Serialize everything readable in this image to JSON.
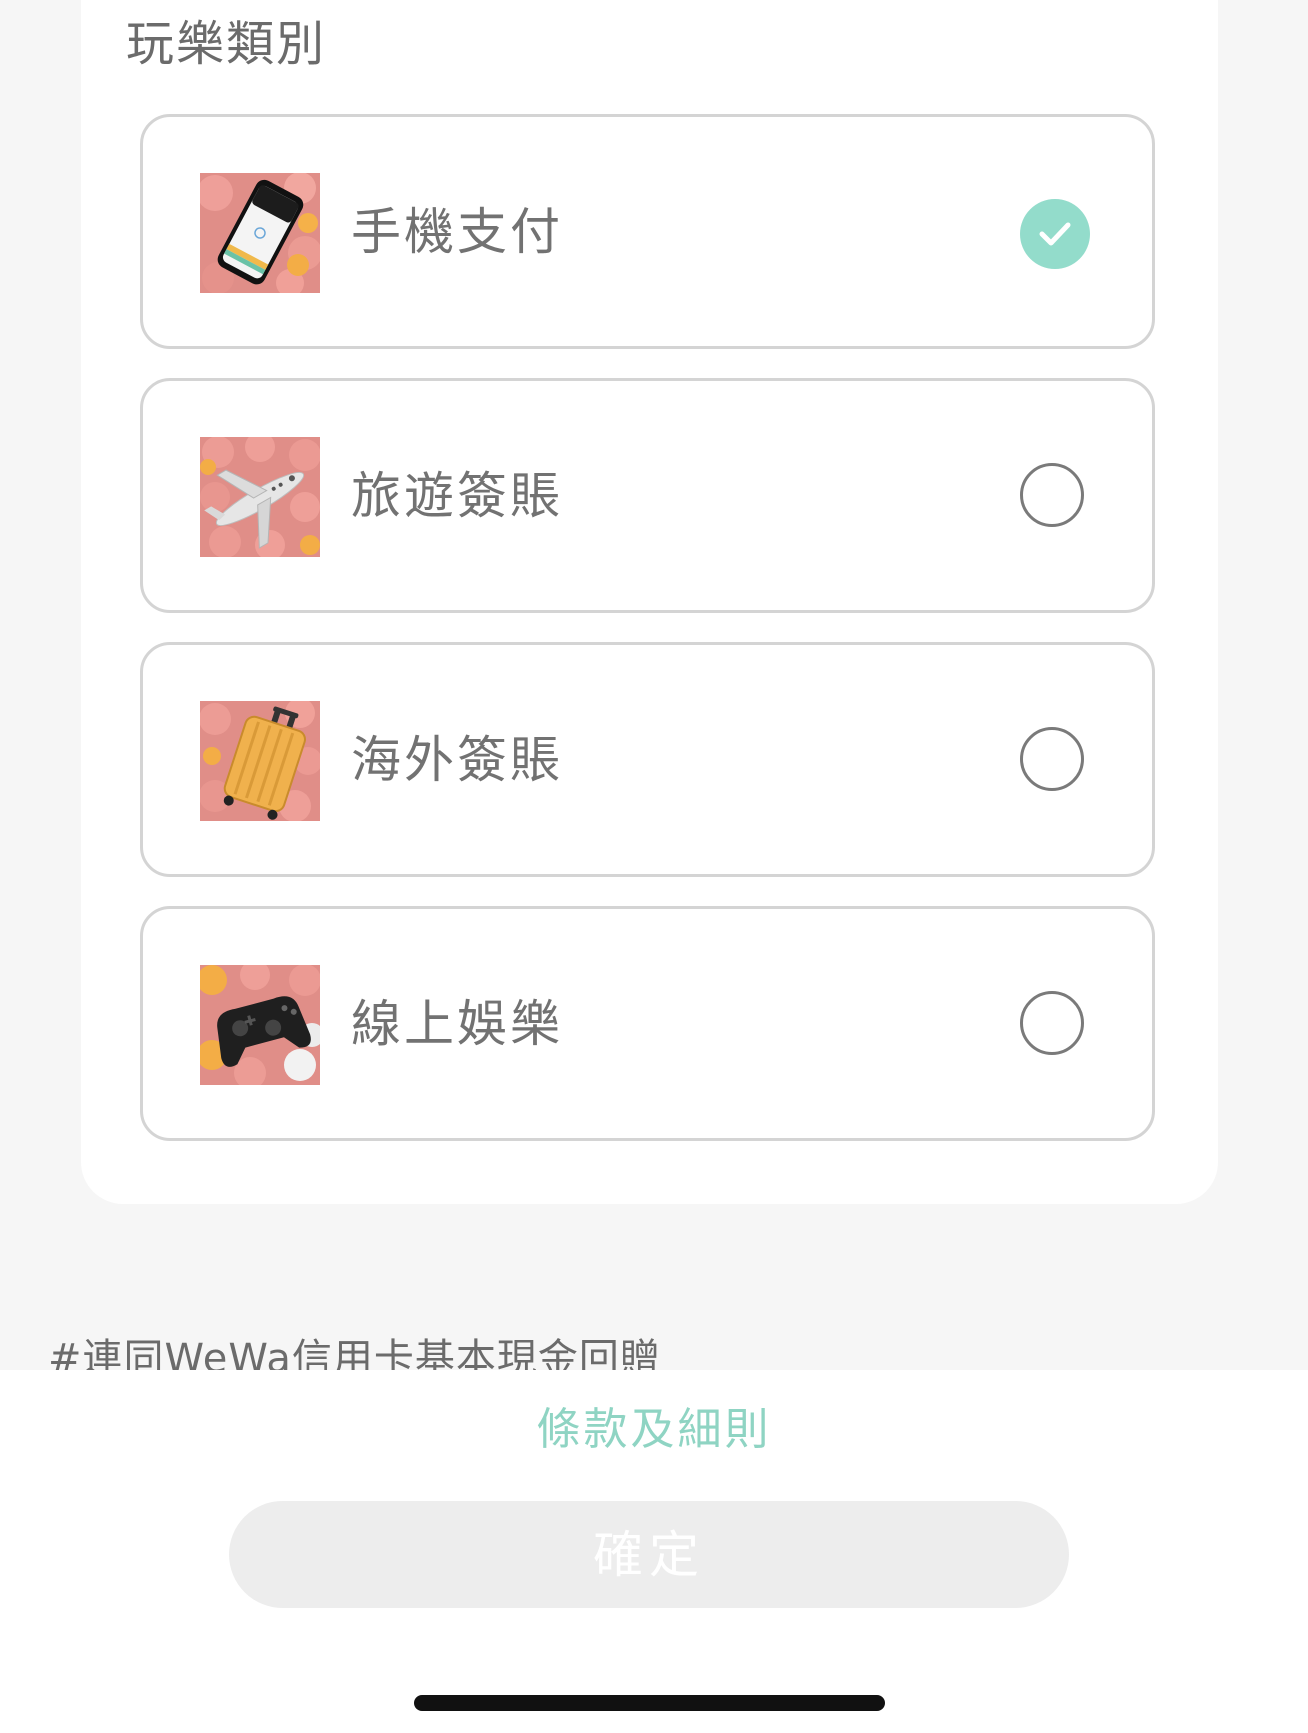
{
  "section": {
    "title": "玩樂類別"
  },
  "options": [
    {
      "label": "手機支付",
      "icon": "phone-payment-image",
      "selected": true
    },
    {
      "label": "旅遊簽賬",
      "icon": "airplane-image",
      "selected": false
    },
    {
      "label": "海外簽賬",
      "icon": "suitcase-image",
      "selected": false
    },
    {
      "label": "線上娛樂",
      "icon": "gamepad-image",
      "selected": false
    }
  ],
  "footnote": "#連同WeWa信用卡基本現金回贈",
  "footer": {
    "terms_label": "條款及細則",
    "confirm_label": "確定"
  },
  "colors": {
    "accent": "#93dccb",
    "thumb_background": "#e79a93",
    "button_disabled_bg": "#ededed"
  }
}
